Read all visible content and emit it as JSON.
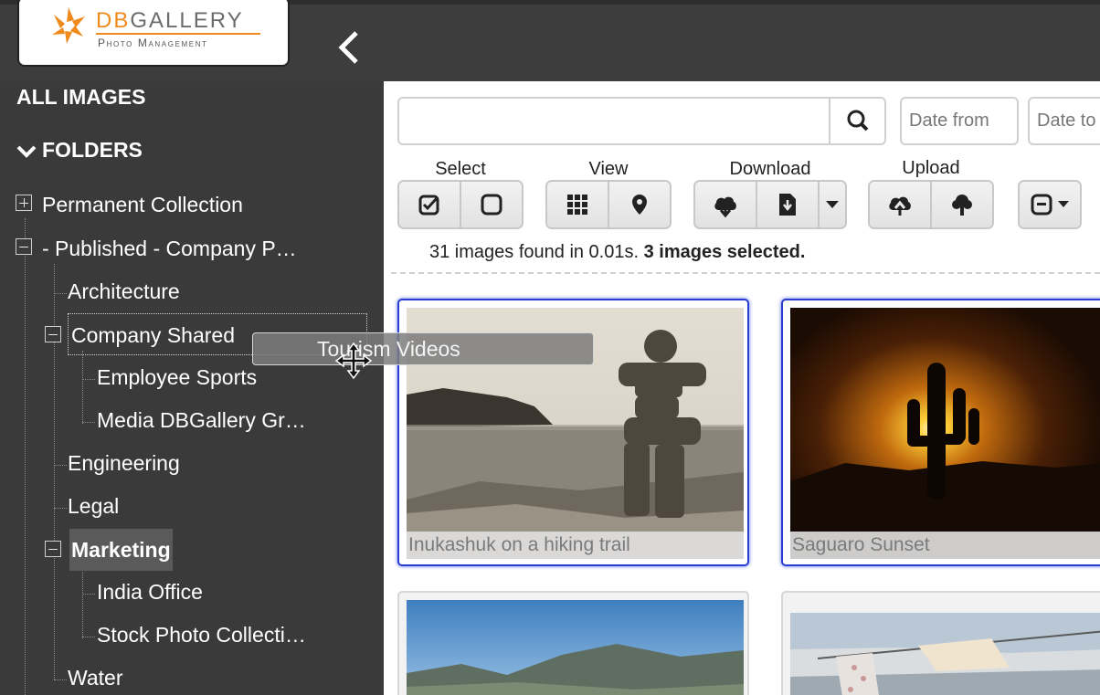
{
  "app": {
    "logo_title_prefix": "DB",
    "logo_title_rest": "GALLERY",
    "logo_subtitle": "Photo Management",
    "brand_color": "#f08a1c"
  },
  "sidebar": {
    "all_images": "ALL IMAGES",
    "folders": "FOLDERS",
    "tree": [
      {
        "label": "Permanent Collection",
        "state": "collapsed"
      },
      {
        "label": "- Published - Company P…",
        "state": "expanded"
      },
      {
        "label": "Architecture"
      },
      {
        "label": "Company Shared",
        "state": "expanded",
        "drop_target": true
      },
      {
        "label": "Employee Sports"
      },
      {
        "label": "Media DBGallery Gr…"
      },
      {
        "label": "Engineering"
      },
      {
        "label": "Legal"
      },
      {
        "label": "Marketing",
        "state": "expanded",
        "selected": true
      },
      {
        "label": "India Office"
      },
      {
        "label": "Stock Photo Collecti…"
      },
      {
        "label": "Water"
      }
    ],
    "drag_ghost_label": "Tourism Videos"
  },
  "toolbar": {
    "search_placeholder": "",
    "date_from_placeholder": "Date from",
    "date_to_placeholder": "Date to",
    "groups": {
      "select": "Select",
      "view": "View",
      "download": "Download",
      "upload": "Upload"
    },
    "icons": {
      "select": [
        "select-all-icon",
        "deselect-icon"
      ],
      "view": [
        "grid-view-icon",
        "map-view-icon"
      ],
      "download": [
        "cloud-download-icon",
        "file-download-icon",
        "dropdown-caret-icon"
      ],
      "upload": [
        "cloud-upload-icon",
        "tree-upload-icon"
      ],
      "more": [
        "menu-box-icon",
        "dropdown-caret-icon"
      ]
    }
  },
  "results": {
    "status_plain": "31 images found in 0.01s.",
    "status_bold": "3 images selected.",
    "images": [
      {
        "caption": "Inukashuk on a hiking trail",
        "selected": true
      },
      {
        "caption": "Saguaro Sunset",
        "selected": true
      },
      {
        "caption": "",
        "selected": false
      },
      {
        "caption": "",
        "selected": false
      }
    ]
  }
}
